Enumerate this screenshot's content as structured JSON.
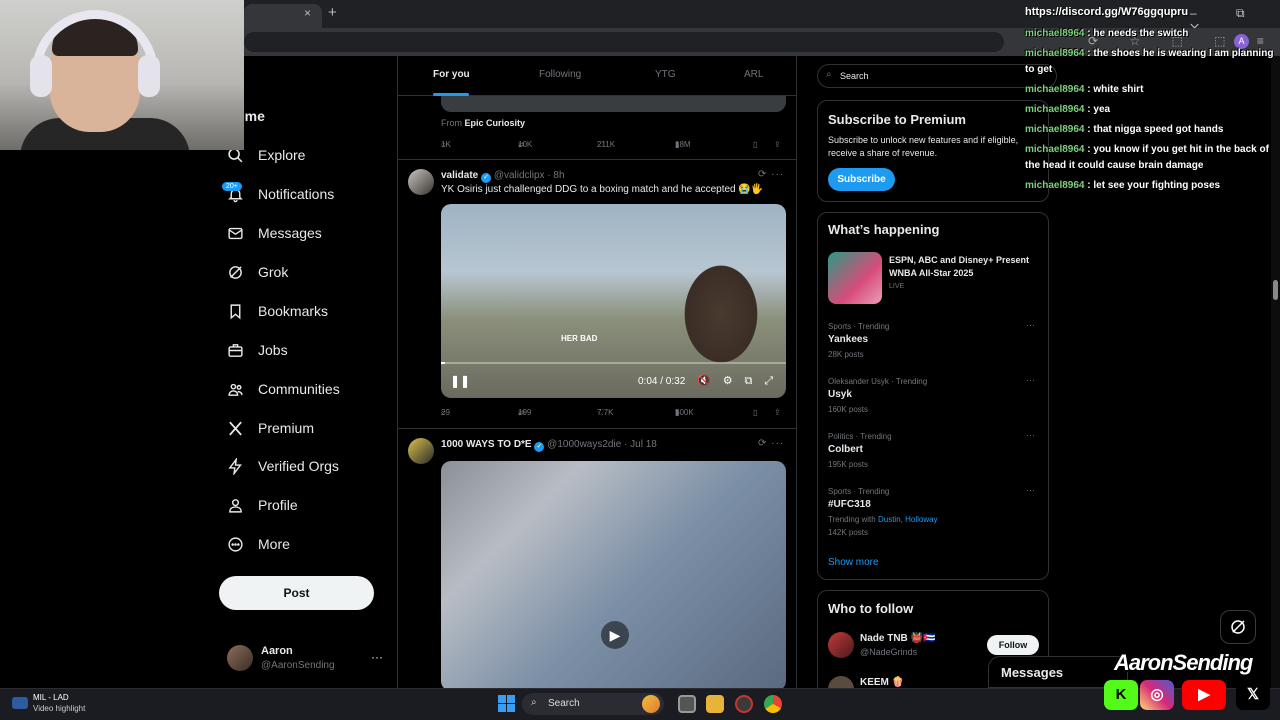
{
  "browser": {
    "tab_close": "×",
    "new_tab": "+",
    "window_controls": "– ⧉ ✕",
    "toolbar_icons": "⟳ ☆ ⬚ ⬚ ≡",
    "profile_initial": "A"
  },
  "nav": {
    "items": [
      {
        "label": "Home",
        "icon": "home-icon"
      },
      {
        "label": "Explore",
        "icon": "search-icon"
      },
      {
        "label": "Notifications",
        "icon": "bell-icon"
      },
      {
        "label": "Messages",
        "icon": "mail-icon"
      },
      {
        "label": "Grok",
        "icon": "grok-icon"
      },
      {
        "label": "Bookmarks",
        "icon": "bookmark-icon"
      },
      {
        "label": "Jobs",
        "icon": "briefcase-icon"
      },
      {
        "label": "Communities",
        "icon": "people-icon"
      },
      {
        "label": "Premium",
        "icon": "x-logo-icon"
      },
      {
        "label": "Verified Orgs",
        "icon": "lightning-icon"
      },
      {
        "label": "Profile",
        "icon": "person-icon"
      },
      {
        "label": "More",
        "icon": "more-circle-icon"
      }
    ],
    "notifications_badge": "20+",
    "post_label": "Post",
    "account": {
      "name": "Aaron",
      "handle": "@AaronSending",
      "more": "···"
    }
  },
  "timeline": {
    "tabs": [
      "For you",
      "Following",
      "YTG",
      "ARL"
    ],
    "prev_tweet": {
      "from_label": "From",
      "from_name": "Epic Curiosity",
      "replies": "1K",
      "reposts": "10K",
      "likes": "211K",
      "views": "18M"
    },
    "tweets": [
      {
        "name": "validate",
        "handle": "@validclipx · 8h",
        "text": "YK Osiris just challenged DDG to a boxing match and he accepted 😭🖐",
        "video_time": "0:04 / 0:32",
        "video_caption": "HER BAD",
        "replies": "29",
        "reposts": "199",
        "likes": "7.7K",
        "views": "500K"
      },
      {
        "name": "1000 WAYS TO D*E",
        "handle": "@1000ways2die · Jul 18"
      }
    ]
  },
  "sidebar": {
    "search_placeholder": "Search",
    "premium": {
      "title": "Subscribe to Premium",
      "desc": "Subscribe to unlock new features and if eligible, receive a share of revenue.",
      "button": "Subscribe"
    },
    "happening": {
      "title": "What’s happening",
      "featured": {
        "title": "ESPN, ABC and Disney+ Present WNBA All-Star 2025",
        "status": "LIVE"
      },
      "trends": [
        {
          "meta": "Sports · Trending",
          "name": "Yankees",
          "count": "28K posts"
        },
        {
          "meta": "Oleksander Usyk · Trending",
          "name": "Usyk",
          "count": "160K posts"
        },
        {
          "meta": "Politics · Trending",
          "name": "Colbert",
          "count": "195K posts"
        },
        {
          "meta": "Sports · Trending",
          "name": "#UFC318",
          "with_label": "Trending with",
          "with_names": "Dustin, Holloway",
          "count": "142K posts"
        }
      ],
      "show_more": "Show more"
    },
    "who_to_follow": {
      "title": "Who to follow",
      "users": [
        {
          "name": "Nade TNB 👹🇨🇺",
          "handle": "@NadeGrinds",
          "button": "Follow"
        },
        {
          "name": "KEEM 🍿"
        }
      ]
    },
    "messages_drawer": "Messages"
  },
  "stream": {
    "discord": "https://discord.gg/W76ggqupru",
    "chat": [
      {
        "user": "michael8964",
        "msg": "he needs the switch"
      },
      {
        "user": "michael8964",
        "msg": "the shoes he is wearing I am planning to get"
      },
      {
        "user": "michael8964",
        "msg": "white shirt"
      },
      {
        "user": "michael8964",
        "msg": "yea"
      },
      {
        "user": "michael8964",
        "msg": "that nigga speed got hands"
      },
      {
        "user": "michael8964",
        "msg": "you know if you get hit in the back of the head it could cause brain damage"
      },
      {
        "user": "michael8964",
        "msg": "let see your fighting poses"
      }
    ],
    "brand": "AaronSending",
    "socials": [
      {
        "name": "kick",
        "glyph": "K",
        "color": "#53fc18"
      },
      {
        "name": "instagram",
        "glyph": "◎",
        "color": "#d62976"
      },
      {
        "name": "youtube",
        "glyph": "▶",
        "color": "#ff0000"
      },
      {
        "name": "x",
        "glyph": "𝕏",
        "color": "#000000"
      }
    ]
  },
  "taskbar": {
    "weather_line1": "MIL - LAD",
    "weather_line2": "Video highlight",
    "search": "Search"
  }
}
